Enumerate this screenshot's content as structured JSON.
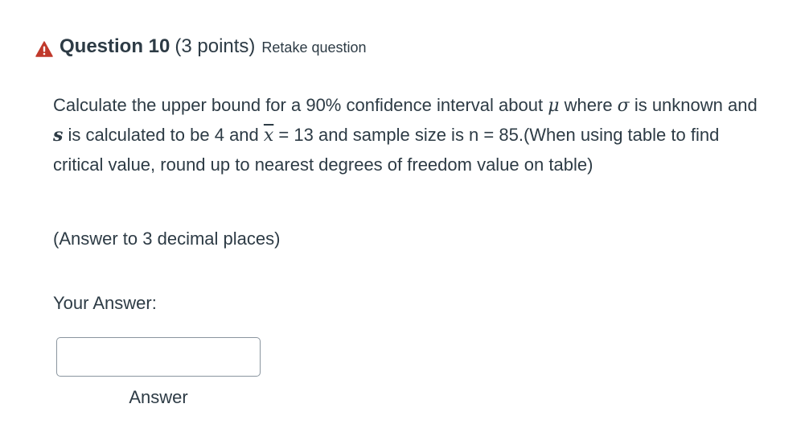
{
  "header": {
    "icon": "warning-triangle-icon",
    "icon_color": "#c0392b",
    "title": "Question 10",
    "points": "(3 points)",
    "retake_link": "Retake question"
  },
  "question": {
    "p1": "Calculate the upper bound for a 90% confidence interval about ",
    "mu": "μ",
    "p2": " where ",
    "sigma": "σ",
    "p3": " is unknown and ",
    "s": "s",
    "p4": " is calculated to be 4 and ",
    "xbar": "x",
    "p5": " = 13 and sample size is n = 85.(When using table to find critical value, round up to nearest degrees of freedom value on table)"
  },
  "answer_note": "(Answer to 3 decimal places)",
  "answer": {
    "label": "Your Answer:",
    "value": "",
    "caption": "Answer"
  }
}
